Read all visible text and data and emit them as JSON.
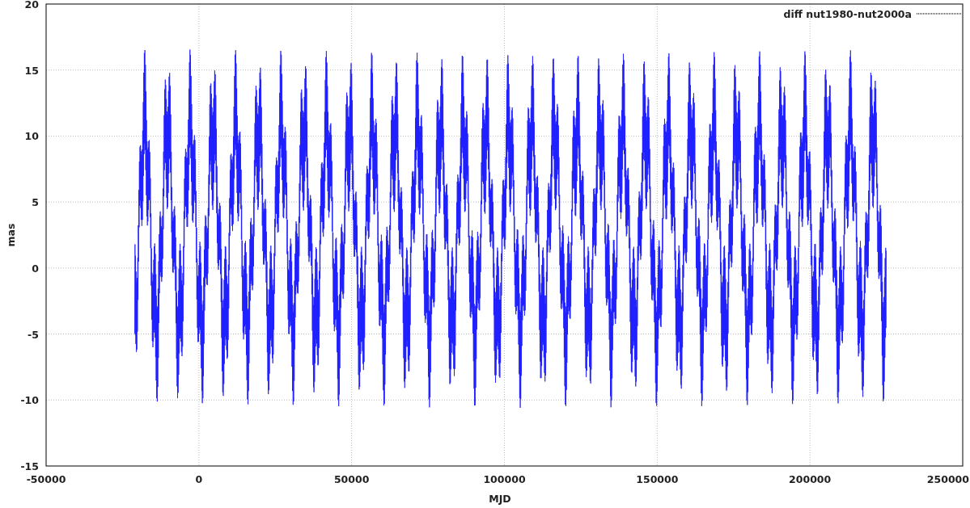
{
  "chart": {
    "legend": {
      "label": "diff nut1980-nut2000a"
    },
    "xlabel": "MJD",
    "ylabel": "mas",
    "xticks": [
      "-50000",
      "0",
      "50000",
      "100000",
      "150000",
      "200000",
      "250000"
    ],
    "yticks": [
      "20",
      "15",
      "10",
      "5",
      "0",
      "-5",
      "-10",
      "-15"
    ]
  }
}
